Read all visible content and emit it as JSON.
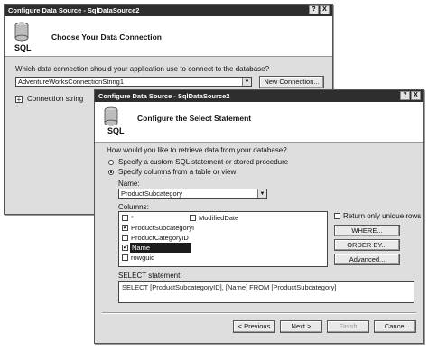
{
  "back_dialog": {
    "title": "Configure Data Source - SqlDataSource2",
    "header": {
      "title": "Choose Your Data Connection",
      "icon": "database-icon",
      "icon_text": "SQL"
    },
    "question": "Which data connection should your application use to connect to the database?",
    "connection_value": "AdventureWorksConnectionString1",
    "new_connection_label": "New Connection...",
    "connection_string_label": "Connection string",
    "expand_symbol": "+",
    "help_symbol": "?",
    "close_symbol": "X"
  },
  "front_dialog": {
    "title": "Configure Data Source - SqlDataSource2",
    "help_symbol": "?",
    "close_symbol": "X",
    "header": {
      "title": "Configure the Select Statement",
      "icon": "database-icon",
      "icon_text": "SQL"
    },
    "question": "How would you like to retrieve data from your database?",
    "radio_custom": "Specify a custom SQL statement or stored procedure",
    "radio_columns": "Specify columns from a table or view",
    "name_label": "Name:",
    "name_value": "ProductSubcategory",
    "columns_label": "Columns:",
    "columns": [
      {
        "label": "*",
        "checked": false
      },
      {
        "label": "ProductSubcategoryI",
        "checked": true
      },
      {
        "label": "ProductCategoryID",
        "checked": false
      },
      {
        "label": "Name",
        "checked": true
      },
      {
        "label": "rowguid",
        "checked": false
      }
    ],
    "column_modified": {
      "label": "ModifiedDate",
      "checked": false
    },
    "unique_rows_label": "Return only unique rows",
    "where_label": "WHERE...",
    "orderby_label": "ORDER BY...",
    "advanced_label": "Advanced...",
    "select_statement_label": "SELECT statement:",
    "select_statement": "SELECT [ProductSubcategoryID], [Name] FROM [ProductSubcategory]",
    "previous_label": "< Previous",
    "next_label": "Next >",
    "finish_label": "Finish",
    "cancel_label": "Cancel",
    "check_mark": "✔"
  },
  "colors": {
    "titlebar": "#2e2e2e",
    "dialog_bg": "#dedede",
    "selection": "#1c1c1c"
  }
}
